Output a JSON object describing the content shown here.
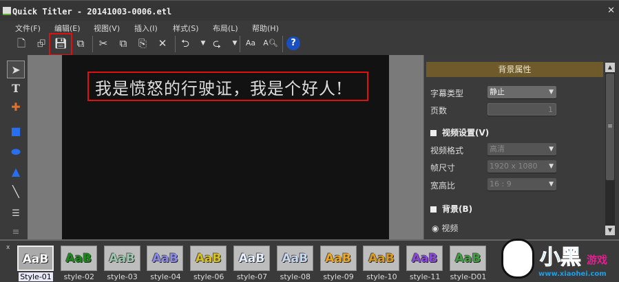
{
  "window": {
    "title": "Quick Titler - 20141003-0006.etl",
    "close": "✕"
  },
  "menu": [
    "文件(F)",
    "编辑(E)",
    "视图(V)",
    "插入(I)",
    "样式(S)",
    "布局(L)",
    "帮助(H)"
  ],
  "canvas": {
    "caption": "我是愤怒的行驶证，我是个好人!"
  },
  "panel": {
    "title": "背景属性",
    "subtitle_type_label": "字幕类型",
    "subtitle_type_value": "静止",
    "pages_label": "页数",
    "pages_value": "1",
    "video_section": "视频设置(V)",
    "video_format_label": "视频格式",
    "video_format_value": "高清",
    "frame_size_label": "帧尺寸",
    "frame_size_value": "1920 x 1080",
    "aspect_label": "宽高比",
    "aspect_value": "16 : 9",
    "bg_section": "背景(B)",
    "bg_video_option": "视频"
  },
  "styles": [
    {
      "name": "Style-01",
      "color": "#ffffff"
    },
    {
      "name": "style-02",
      "color": "#1a8a1a"
    },
    {
      "name": "style-03",
      "color": "#9cc8b0"
    },
    {
      "name": "style-04",
      "color": "#8a88e8"
    },
    {
      "name": "style-06",
      "color": "#d8c020"
    },
    {
      "name": "style-07",
      "color": "#e8f0ff"
    },
    {
      "name": "style-08",
      "color": "#c8d8f0"
    },
    {
      "name": "style-09",
      "color": "#f0a820"
    },
    {
      "name": "style-10",
      "color": "#d89a20"
    },
    {
      "name": "style-11",
      "color": "#8a48d8"
    },
    {
      "name": "style-D01",
      "color": "#40a040"
    }
  ],
  "style_sample": "AaB",
  "watermark": {
    "text": "小黑游戏",
    "url": "www.xiaohei.com"
  }
}
